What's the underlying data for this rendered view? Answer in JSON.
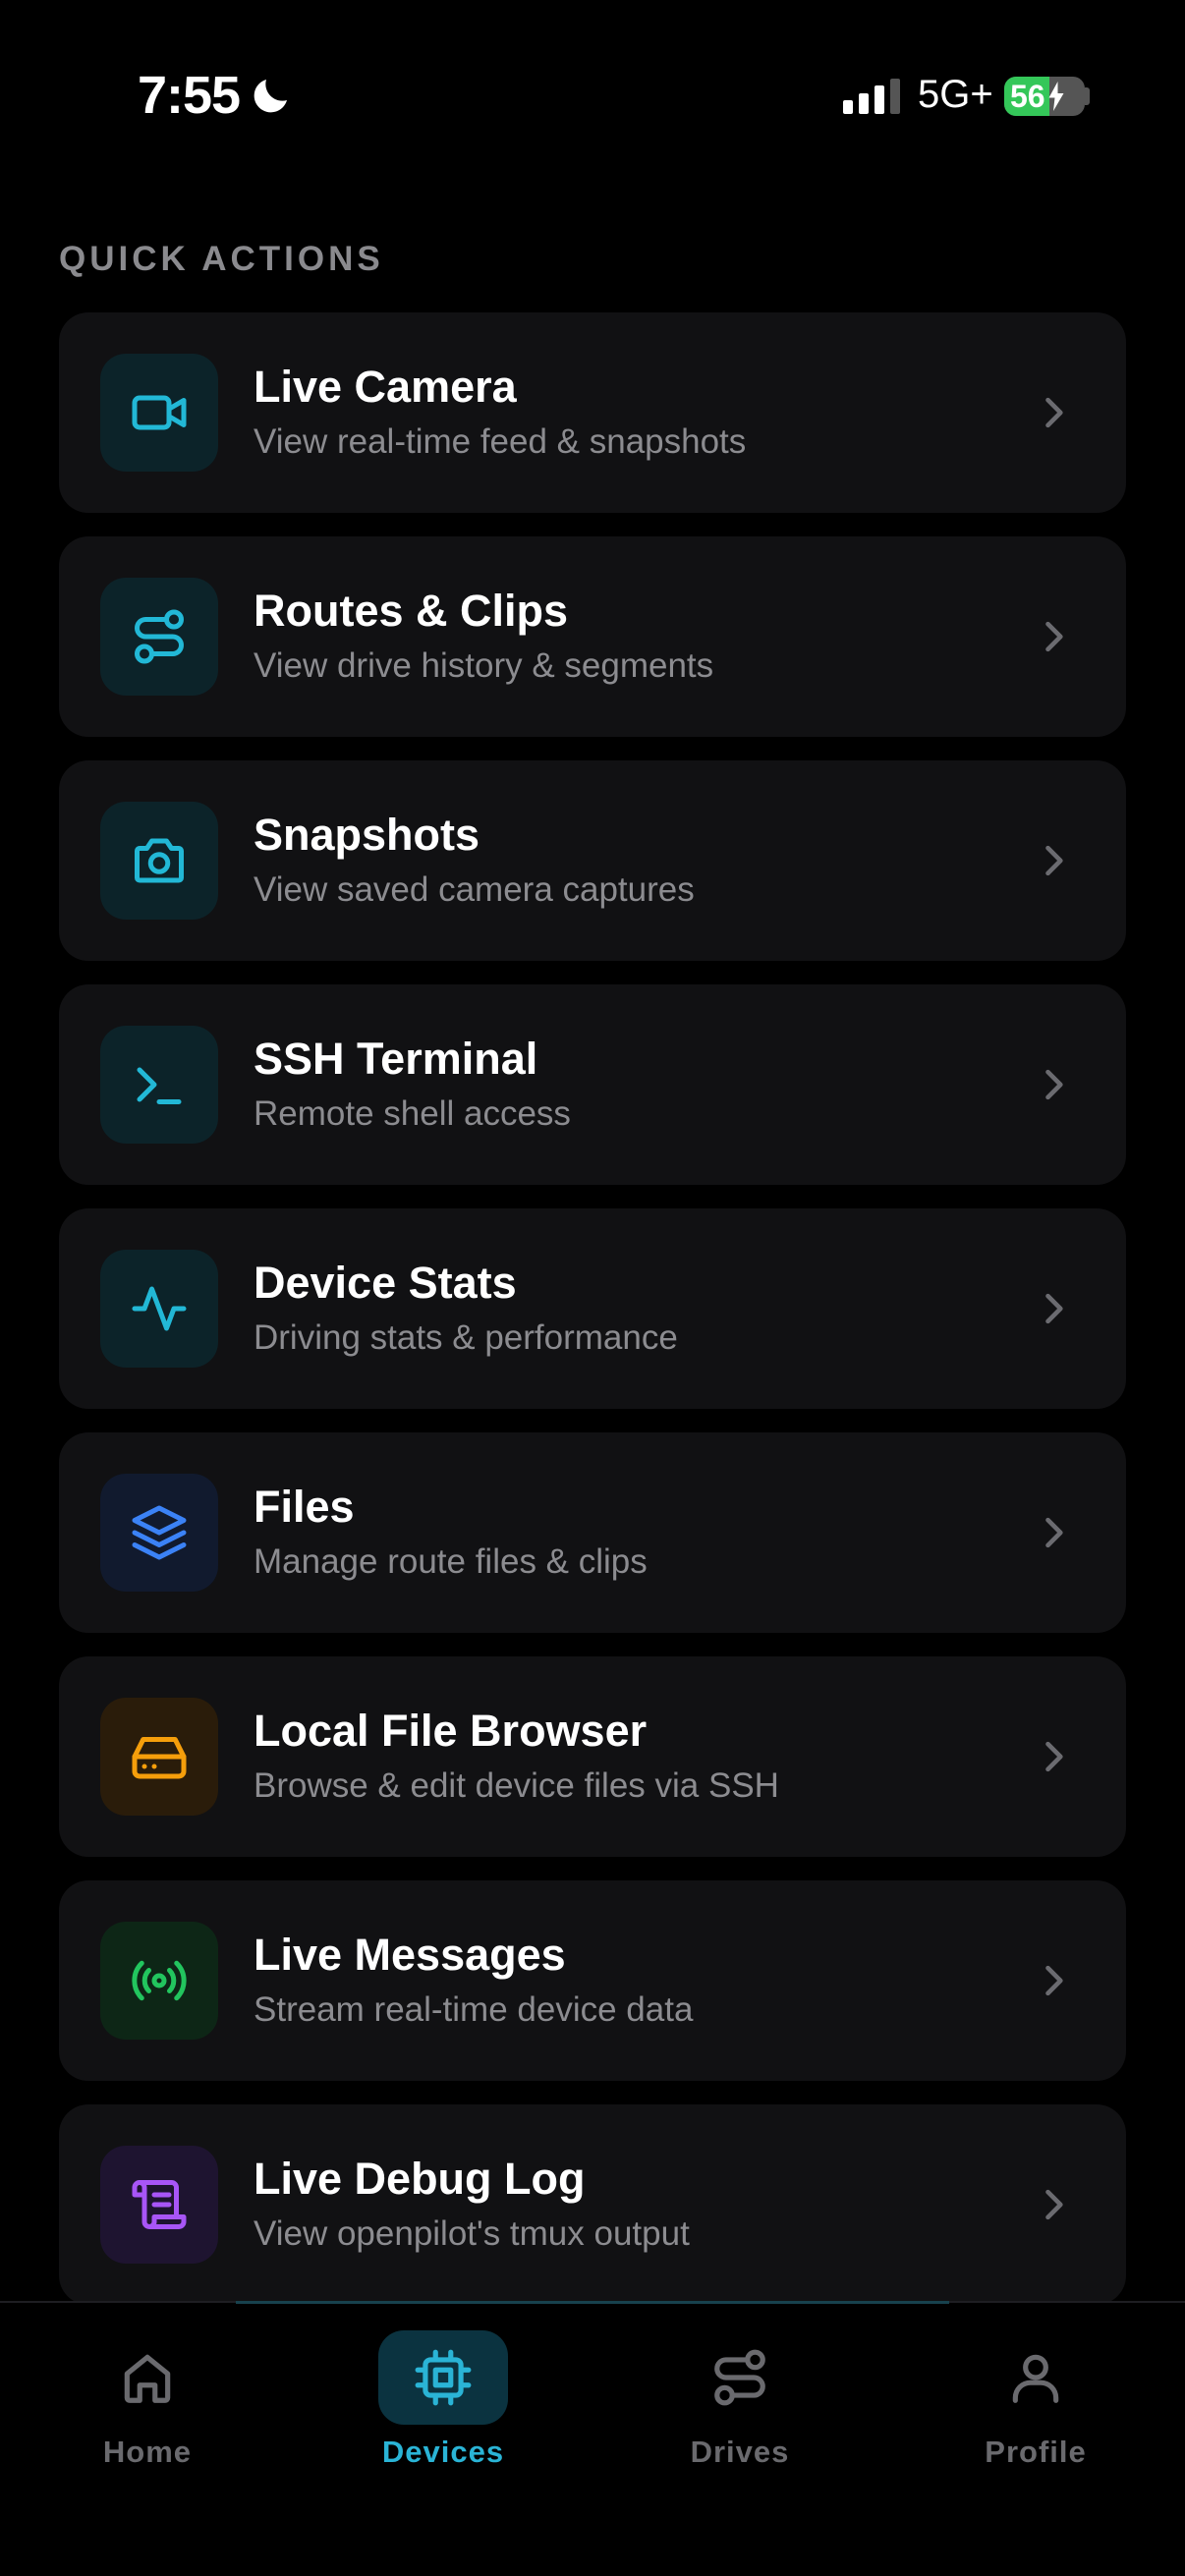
{
  "status_bar": {
    "time": "7:55",
    "network": "5G+",
    "battery_percent": "56",
    "battery_level": 0.56
  },
  "section": {
    "title": "QUICK ACTIONS"
  },
  "actions": [
    {
      "title": "Live Camera",
      "subtitle": "View real-time feed & snapshots",
      "icon": "video-camera-icon",
      "color": "#22b8d6"
    },
    {
      "title": "Routes & Clips",
      "subtitle": "View drive history & segments",
      "icon": "route-icon",
      "color": "#22b8d6"
    },
    {
      "title": "Snapshots",
      "subtitle": "View saved camera captures",
      "icon": "camera-icon",
      "color": "#22b8d6"
    },
    {
      "title": "SSH Terminal",
      "subtitle": "Remote shell access",
      "icon": "terminal-icon",
      "color": "#22b8d6"
    },
    {
      "title": "Device Stats",
      "subtitle": "Driving stats & performance",
      "icon": "activity-icon",
      "color": "#22b8d6"
    },
    {
      "title": "Files",
      "subtitle": "Manage route files & clips",
      "icon": "layers-icon",
      "color": "#3b82f6"
    },
    {
      "title": "Local File Browser",
      "subtitle": "Browse & edit device files via SSH",
      "icon": "hard-drive-icon",
      "color": "#f59e0b"
    },
    {
      "title": "Live Messages",
      "subtitle": "Stream real-time device data",
      "icon": "radio-icon",
      "color": "#22c55e"
    },
    {
      "title": "Live Debug Log",
      "subtitle": "View openpilot's tmux output",
      "icon": "scroll-icon",
      "color": "#a855f7"
    }
  ],
  "tabs": [
    {
      "label": "Home",
      "icon": "home-icon",
      "active": false
    },
    {
      "label": "Devices",
      "icon": "chip-icon",
      "active": true
    },
    {
      "label": "Drives",
      "icon": "route-icon",
      "active": false
    },
    {
      "label": "Profile",
      "icon": "user-icon",
      "active": false
    }
  ],
  "colors": {
    "accent": "#2ab4d6",
    "card_bg": "#111113",
    "muted": "#8c8c90"
  }
}
